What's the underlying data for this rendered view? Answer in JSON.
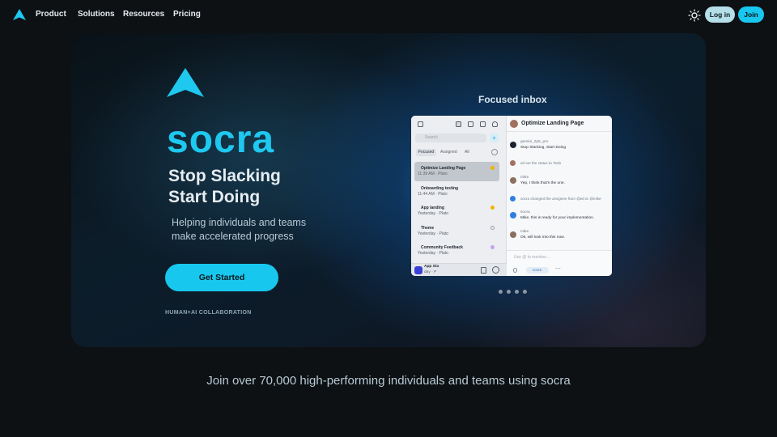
{
  "nav": {
    "links": [
      "Product",
      "Solutions",
      "Resources",
      "Pricing"
    ],
    "login_label": "Log in",
    "join_label": "Join",
    "icons": {
      "logo": "socra-arrow-logo",
      "theme": "sun-icon"
    }
  },
  "hero": {
    "brand": "socra",
    "title_line1": "Stop Slacking",
    "title_line2": "Start Doing",
    "subtitle_line1": "Helping individuals and teams",
    "subtitle_line2": "make accelerated progress",
    "cta_label": "Get Started",
    "tagline": "HUMAN+AI COLLABORATION",
    "inbox_label": "Focused inbox"
  },
  "app": {
    "search_placeholder": "Search",
    "filters": [
      "Focused",
      "Assigned",
      "All"
    ],
    "items": [
      {
        "title": "Optimize Landing Page",
        "meta": "11:39 AM · Plato",
        "color": "#f0b400"
      },
      {
        "title": "Onboarding testing",
        "meta": "11:44 AM · Plato",
        "color": "#9aa0a8"
      },
      {
        "title": "App landing",
        "meta": "Yesterday · Plato",
        "color": "#f0b400"
      },
      {
        "title": "Theme",
        "meta": "Yesterday · Plato",
        "color": "#9aa0a8"
      },
      {
        "title": "Community Feedback",
        "meta": "Yesterday · Plato",
        "color": "#c9a0f0"
      },
      {
        "title": "App Sta",
        "meta": "day · P",
        "color": "#9aa0a8"
      }
    ],
    "header_title": "Optimize Landing Page",
    "messages": [
      {
        "who": "gemini_2p5_pro",
        "text": "Stop Slacking, Start Doing",
        "av": "#1b2430"
      },
      {
        "system": "ed set the status to Todo",
        "av": "#a07060"
      },
      {
        "who": "mike",
        "text": "Yep, I think that's the one.",
        "av": "#8a7060"
      },
      {
        "system": "socra changed the assignee from @ed to @mike",
        "av": "#2f7fe0"
      },
      {
        "who": "socra",
        "text": "Mike, this is ready for your implementation.",
        "av": "#2f7fe0"
      },
      {
        "who": "mike",
        "text": "Ok, will look into this now.",
        "av": "#8a7060"
      }
    ],
    "composer_placeholder": "Use @ to mention...",
    "chip_label": "socra"
  },
  "footer": {
    "text": "Join over 70,000 high-performing individuals and teams using socra"
  }
}
